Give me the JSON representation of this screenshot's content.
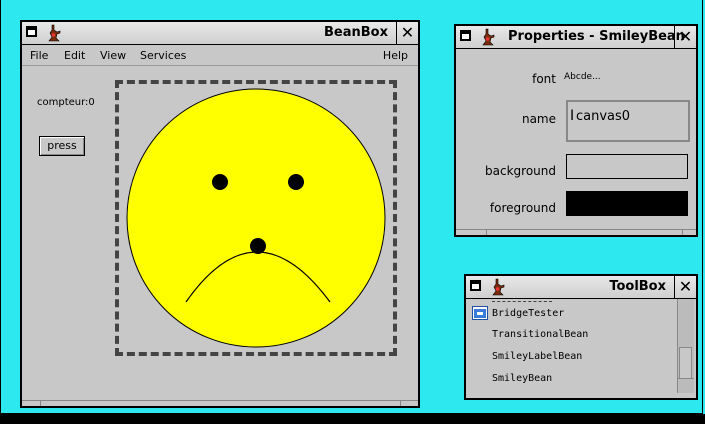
{
  "beanbox": {
    "title": "BeanBox",
    "menu": [
      "File",
      "Edit",
      "View",
      "Services"
    ],
    "help": "Help",
    "counter_label": "compteur:0",
    "press_label": "press"
  },
  "smiley": {
    "face_color": "#ffff00",
    "mood": "sad"
  },
  "properties": {
    "title": "Properties - SmileyBean",
    "font_label": "font",
    "font_sample": "Abcde...",
    "name_label": "name",
    "name_value": "canvas0",
    "background_label": "background",
    "background_color": "#c8c8c8",
    "foreground_label": "foreground",
    "foreground_color": "#000000"
  },
  "toolbox": {
    "title": "ToolBox",
    "items": [
      "BridgeTester",
      "TransitionalBean",
      "SmileyLabelBean",
      "SmileyBean"
    ]
  },
  "colors": {
    "desktop": "#2ee8f0",
    "window_bg": "#c8c8c8"
  }
}
